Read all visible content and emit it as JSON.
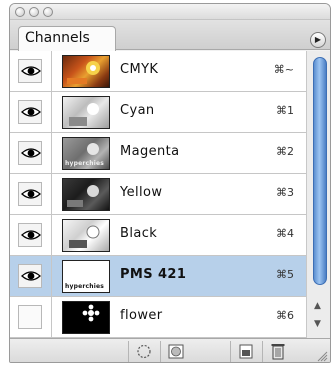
{
  "panel": {
    "tab_label": "Channels",
    "menu_icon": "flyout-menu-icon"
  },
  "channels": [
    {
      "name": "CMYK",
      "shortcut": "⌘~",
      "visible": true,
      "selected": false,
      "thumb": "color"
    },
    {
      "name": "Cyan",
      "shortcut": "⌘1",
      "visible": true,
      "selected": false,
      "thumb": "gray-light"
    },
    {
      "name": "Magenta",
      "shortcut": "⌘2",
      "visible": true,
      "selected": false,
      "thumb": "gray-mid",
      "caption": "hyperchies"
    },
    {
      "name": "Yellow",
      "shortcut": "⌘3",
      "visible": true,
      "selected": false,
      "thumb": "gray-dark"
    },
    {
      "name": "Black",
      "shortcut": "⌘4",
      "visible": true,
      "selected": false,
      "thumb": "gray-light"
    },
    {
      "name": "PMS 421",
      "shortcut": "⌘5",
      "visible": true,
      "selected": true,
      "thumb": "white",
      "caption": "hyperchies"
    },
    {
      "name": "flower",
      "shortcut": "⌘6",
      "visible": false,
      "selected": false,
      "thumb": "black"
    }
  ],
  "bottom_tools": [
    {
      "name": "load-channel-as-selection-icon"
    },
    {
      "name": "save-selection-as-channel-icon"
    },
    {
      "name": "new-channel-icon"
    },
    {
      "name": "trash-icon"
    }
  ],
  "colors": {
    "selected_row": "#b7d0ea",
    "scroll_thumb": "#6d9edc"
  }
}
